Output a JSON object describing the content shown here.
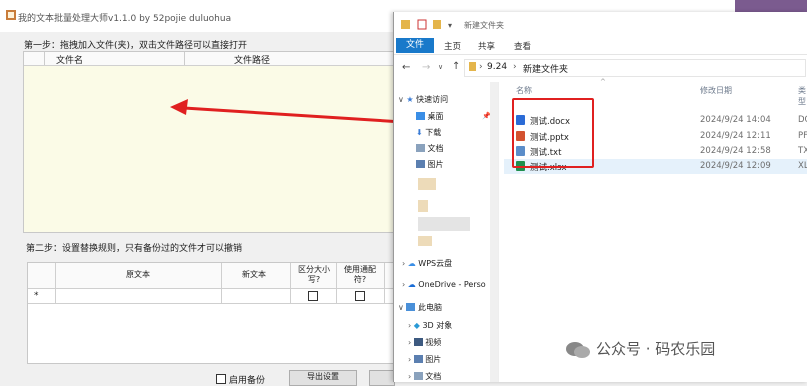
{
  "app": {
    "title": "我的文本批量处理大师v1.1.0 by 52pojie duluohua",
    "step1": "第一步：拖拽加入文件(夹)，双击文件路径可以直接打开",
    "file_list_columns": [
      "文件名",
      "文件路径"
    ],
    "step2": "第二步：设置替换规则，只有备份过的文件才可以撤销",
    "rules_columns": [
      "原文本",
      "新文本",
      "区分大小写?",
      "使用通配符?"
    ],
    "row_marker": "*",
    "enable_backup_label": "启用备份",
    "export_button": "导出设置"
  },
  "explorer": {
    "title": "新建文件夹",
    "tabs": [
      "文件",
      "主页",
      "共享",
      "查看"
    ],
    "breadcrumb": [
      "9.24",
      "新建文件夹"
    ],
    "columns": {
      "name": "名称",
      "modified": "修改日期",
      "type": "类型"
    },
    "nav": {
      "quick_access": "快速访问",
      "desktop": "桌面",
      "downloads": "下载",
      "documents": "文档",
      "pictures": "图片",
      "wps": "WPS云盘",
      "onedrive": "OneDrive - Perso",
      "this_pc": "此电脑",
      "objects3d": "3D 对象",
      "videos": "视频",
      "pictures2": "图片",
      "documents2": "文档"
    },
    "files": [
      {
        "name": "测试.docx",
        "date": "2024/9/24 14:04",
        "type": "DO",
        "color": "#2b6bd6"
      },
      {
        "name": "测试.pptx",
        "date": "2024/9/24 12:11",
        "type": "PF",
        "color": "#d35230"
      },
      {
        "name": "测试.txt",
        "date": "2024/9/24 12:58",
        "type": "TX",
        "color": "#5b8dc9"
      },
      {
        "name": "测试.xlsx",
        "date": "2024/9/24 12:09",
        "type": "XL",
        "color": "#1f8f4e"
      }
    ]
  },
  "watermark": "公众号 · 码农乐园",
  "colors": {
    "accent": "#1979ca",
    "highlight": "#e02020",
    "selected": "#e5f1fb"
  }
}
